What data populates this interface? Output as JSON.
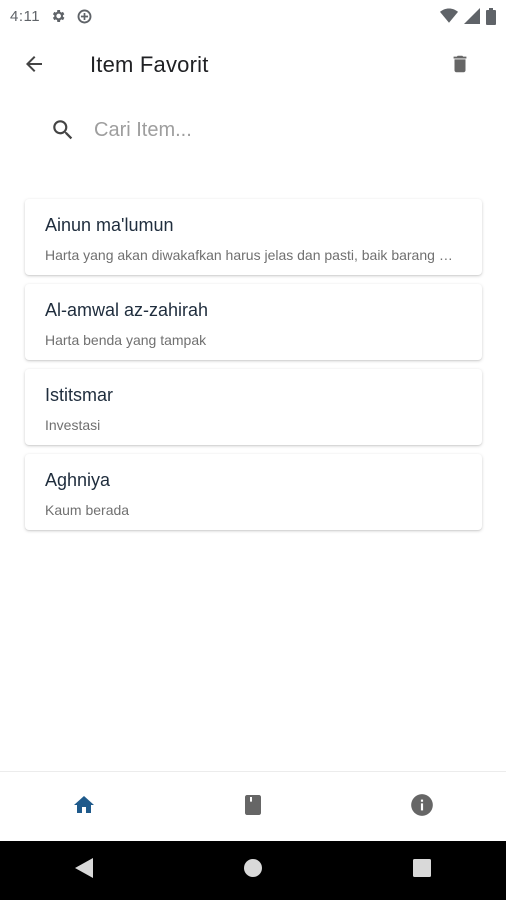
{
  "status_bar": {
    "time": "4:11",
    "icons": [
      "gear-icon",
      "data-saver-icon",
      "wifi-icon",
      "signal-icon",
      "battery-icon"
    ]
  },
  "app_bar": {
    "title": "Item Favorit",
    "back_icon": "arrow-left-icon",
    "delete_icon": "trash-icon"
  },
  "search": {
    "placeholder": "Cari Item...",
    "value": "",
    "icon": "search-icon"
  },
  "items": [
    {
      "title": "Ainun ma'lumun",
      "subtitle": "Harta yang akan diwakafkan harus jelas dan pasti, baik barang maupun jumlahnya"
    },
    {
      "title": "Al-amwal az-zahirah",
      "subtitle": "Harta benda yang tampak"
    },
    {
      "title": "Istitsmar",
      "subtitle": "Investasi"
    },
    {
      "title": "Aghniya",
      "subtitle": "Kaum berada"
    }
  ],
  "bottom_nav": {
    "items": [
      {
        "icon": "home-icon",
        "active": true
      },
      {
        "icon": "book-icon",
        "active": false
      },
      {
        "icon": "info-icon",
        "active": false
      }
    ],
    "active_color": "#1f5a8b",
    "inactive_color": "#666666"
  },
  "system_nav": {
    "icons": [
      "back-triangle-icon",
      "home-circle-icon",
      "recents-square-icon"
    ]
  }
}
